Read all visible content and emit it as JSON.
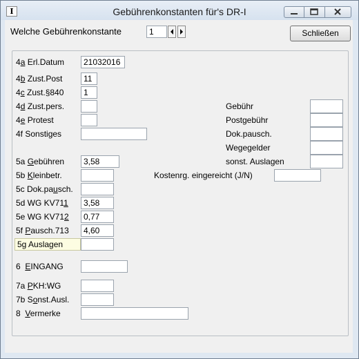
{
  "window": {
    "title": "Gebührenkonstanten für's DR-I"
  },
  "top": {
    "label": "Welche Gebührenkonstante",
    "value": "1",
    "close_label": "Schließen"
  },
  "fields": {
    "f4a": {
      "num": "4a",
      "key": "",
      "rest": " Erl.Datum",
      "value": "21032016",
      "label_ul": "a"
    },
    "f4b": {
      "num": "4",
      "ul": "b",
      "rest": " Zust.Post",
      "value": "11"
    },
    "f4c": {
      "num": "4",
      "ul": "c",
      "rest": " Zust.§840",
      "value": "1"
    },
    "f4d": {
      "num": "4",
      "ul": "d",
      "rest": " Zust.pers.",
      "value": ""
    },
    "f4e": {
      "num": "4",
      "ul": "e",
      "rest": " Protest",
      "value": ""
    },
    "f4f": {
      "num": "4f ",
      "ul": "",
      "rest": "Sonstiges",
      "value": ""
    },
    "f5a": {
      "pre": "5a ",
      "ul": "G",
      "rest": "ebühren",
      "value": "3,58"
    },
    "f5b": {
      "pre": "5b ",
      "ul": "K",
      "rest": "leinbetr.",
      "value": ""
    },
    "f5c": {
      "pre": "5c Dok.pa",
      "ul": "u",
      "rest": "sch.",
      "value": ""
    },
    "f5d": {
      "pre": "5d WG KV71",
      "ul": "1",
      "rest": "",
      "value": "3,58"
    },
    "f5e": {
      "pre": "5e WG KV71",
      "ul": "2",
      "rest": "",
      "value": "0,77"
    },
    "f5f": {
      "pre": "5f ",
      "ul": "P",
      "rest": "ausch.713",
      "value": "4,60"
    },
    "f5g": {
      "pre": "5g Auslagen",
      "ul": "",
      "rest": "",
      "value": ""
    },
    "f6": {
      "pre": "6  ",
      "ul": "E",
      "rest": "INGANG",
      "value": ""
    },
    "f7a": {
      "pre": "7a ",
      "ul": "P",
      "rest": "KH:WG",
      "value": ""
    },
    "f7b": {
      "pre": "7b S",
      "ul": "o",
      "rest": "nst.Ausl.",
      "value": ""
    },
    "f8": {
      "pre": "8  ",
      "ul": "V",
      "rest": "ermerke",
      "value": ""
    }
  },
  "right": {
    "gebuehr": "Gebühr",
    "postgebuehr": "Postgebühr",
    "dokpausch": "Dok.pausch.",
    "wegegelder": "Wegegelder",
    "sonstauslagen": "sonst. Auslagen",
    "kosten_label": "Kostenrg. eingereicht (J/N)"
  }
}
